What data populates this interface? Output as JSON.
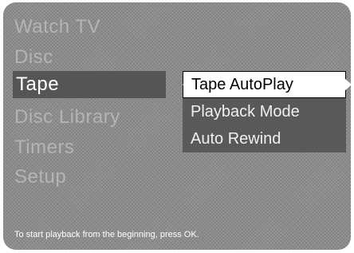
{
  "main_menu": {
    "items": [
      {
        "label": "Watch TV"
      },
      {
        "label": "Disc"
      },
      {
        "label": "Tape",
        "selected": true
      },
      {
        "label": "Disc Library"
      },
      {
        "label": "Timers"
      },
      {
        "label": "Setup"
      }
    ]
  },
  "submenu": {
    "items": [
      {
        "label": "Tape AutoPlay",
        "selected": true
      },
      {
        "label": "Playback Mode"
      },
      {
        "label": "Auto Rewind"
      }
    ]
  },
  "status_text": "To start playback from the beginning, press OK.",
  "colors": {
    "background": "#8c8c8c",
    "highlight": "#555555",
    "submenu_bg": "#595959",
    "inactive_text": "#b4b4b4",
    "selected_text": "#ffffff"
  },
  "icons": {
    "left_arrow": "left-arrow-icon",
    "right_arrow": "right-arrow-icon"
  }
}
